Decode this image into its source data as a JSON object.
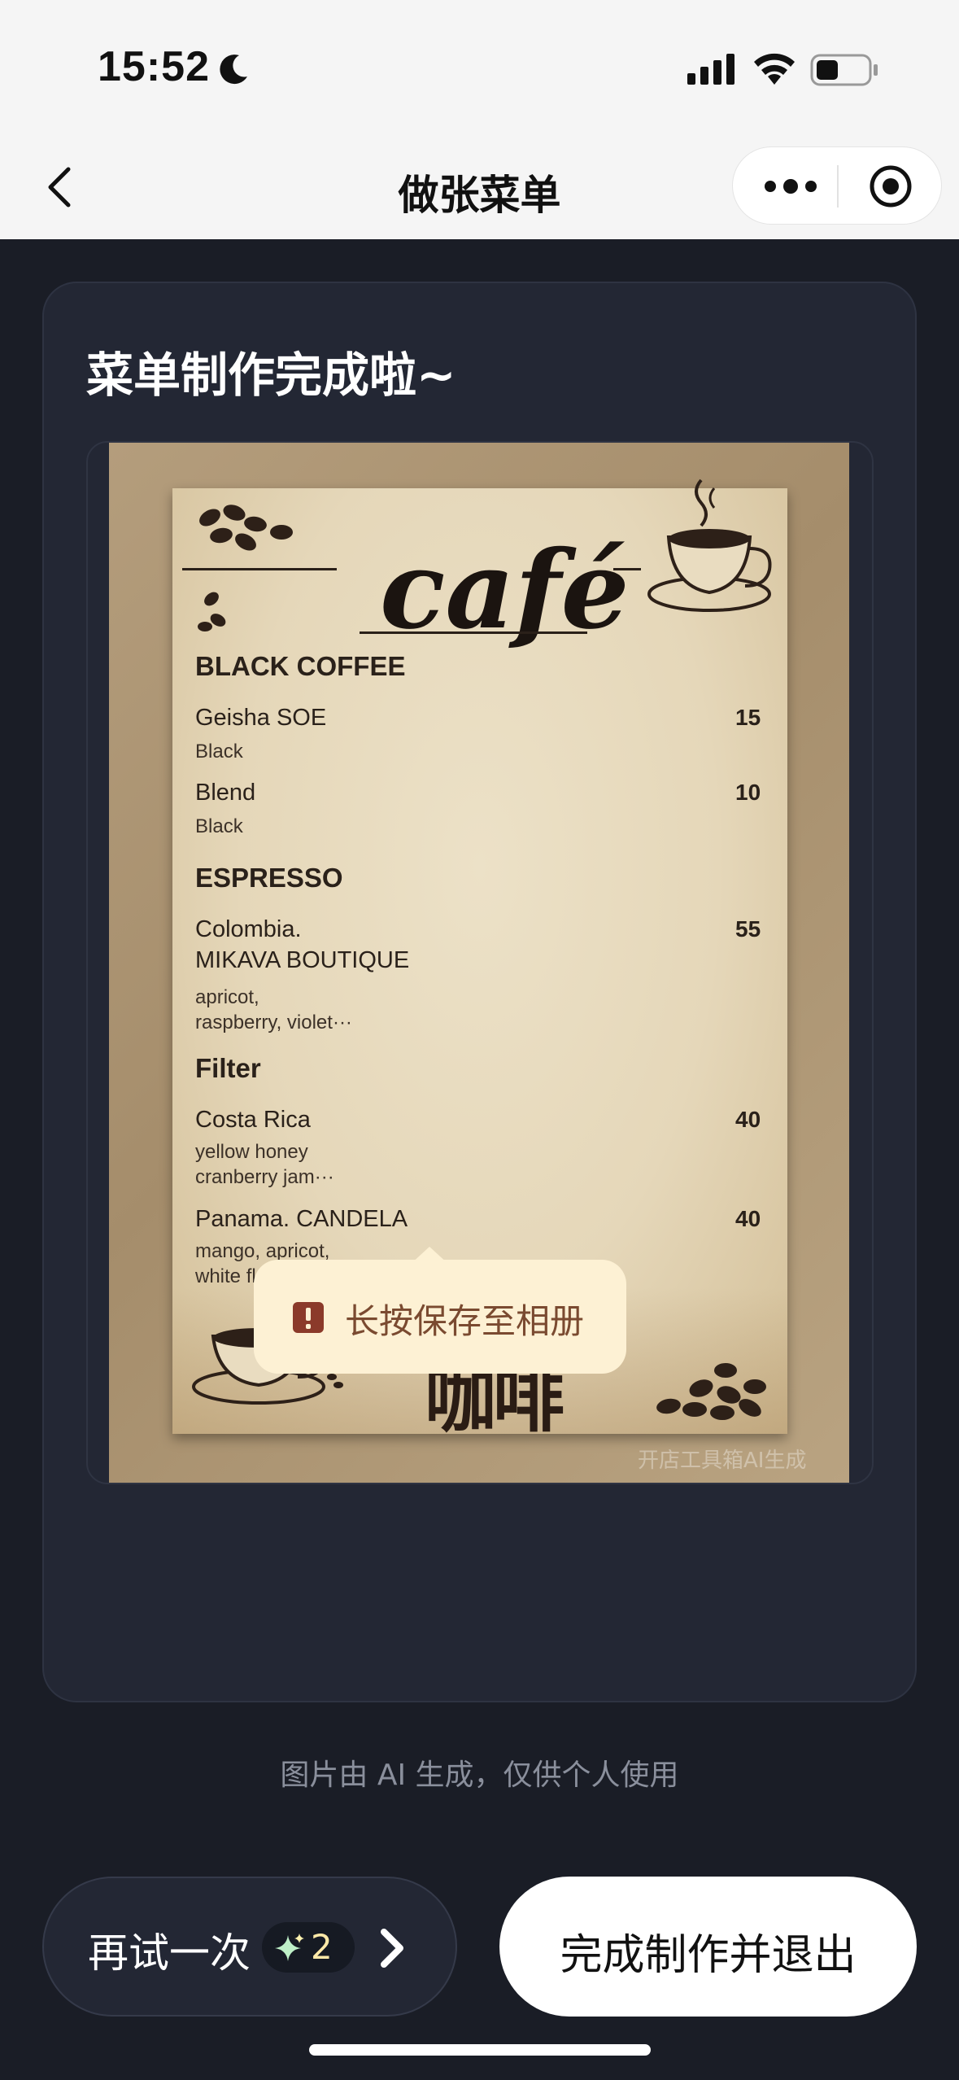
{
  "status_bar": {
    "time": "15:52"
  },
  "nav": {
    "title": "做张菜单"
  },
  "card": {
    "title": "菜单制作完成啦~"
  },
  "menu": {
    "title": "café",
    "sections": [
      {
        "name": "BLACK COFFEE",
        "items": [
          {
            "name": "Geisha SOE",
            "price": "15",
            "desc": [
              "Black"
            ]
          },
          {
            "name": "Blend",
            "price": "10",
            "desc": [
              "Black"
            ]
          }
        ]
      },
      {
        "name": "ESPRESSO",
        "items": [
          {
            "name": "Colombia.",
            "name2": "MIKAVA BOUTIQUE",
            "price": "55",
            "desc": [
              "apricot,",
              "raspberry, violet···"
            ]
          }
        ]
      },
      {
        "name": "Filter",
        "items": [
          {
            "name": "Costa Rica",
            "price": "40",
            "desc": [
              "yellow honey",
              "cranberry jam···"
            ]
          },
          {
            "name": "Panama. CANDELA",
            "price": "40",
            "desc": [
              "mango, apricot,",
              "white floral···"
            ]
          }
        ]
      }
    ],
    "chinese_title": "咖啡",
    "watermark": "开店工具箱AI生成"
  },
  "tooltip": {
    "text": "长按保存至相册"
  },
  "disclaimer": "图片由 AI 生成，仅供个人使用",
  "buttons": {
    "retry": "再试一次",
    "retry_count": "2",
    "finish": "完成制作并退出"
  },
  "colors": {
    "background": "#1a1d26",
    "card": "#232734",
    "tooltip_bg": "#fdf1d4",
    "tooltip_text": "#7a4a30",
    "badge_text": "#ffe9a8"
  },
  "icons": [
    "back-icon",
    "more-icon",
    "target-icon",
    "moon-icon",
    "signal-icon",
    "wifi-icon",
    "battery-icon",
    "warning-icon",
    "sparkle-icon",
    "chevron-right-icon"
  ]
}
